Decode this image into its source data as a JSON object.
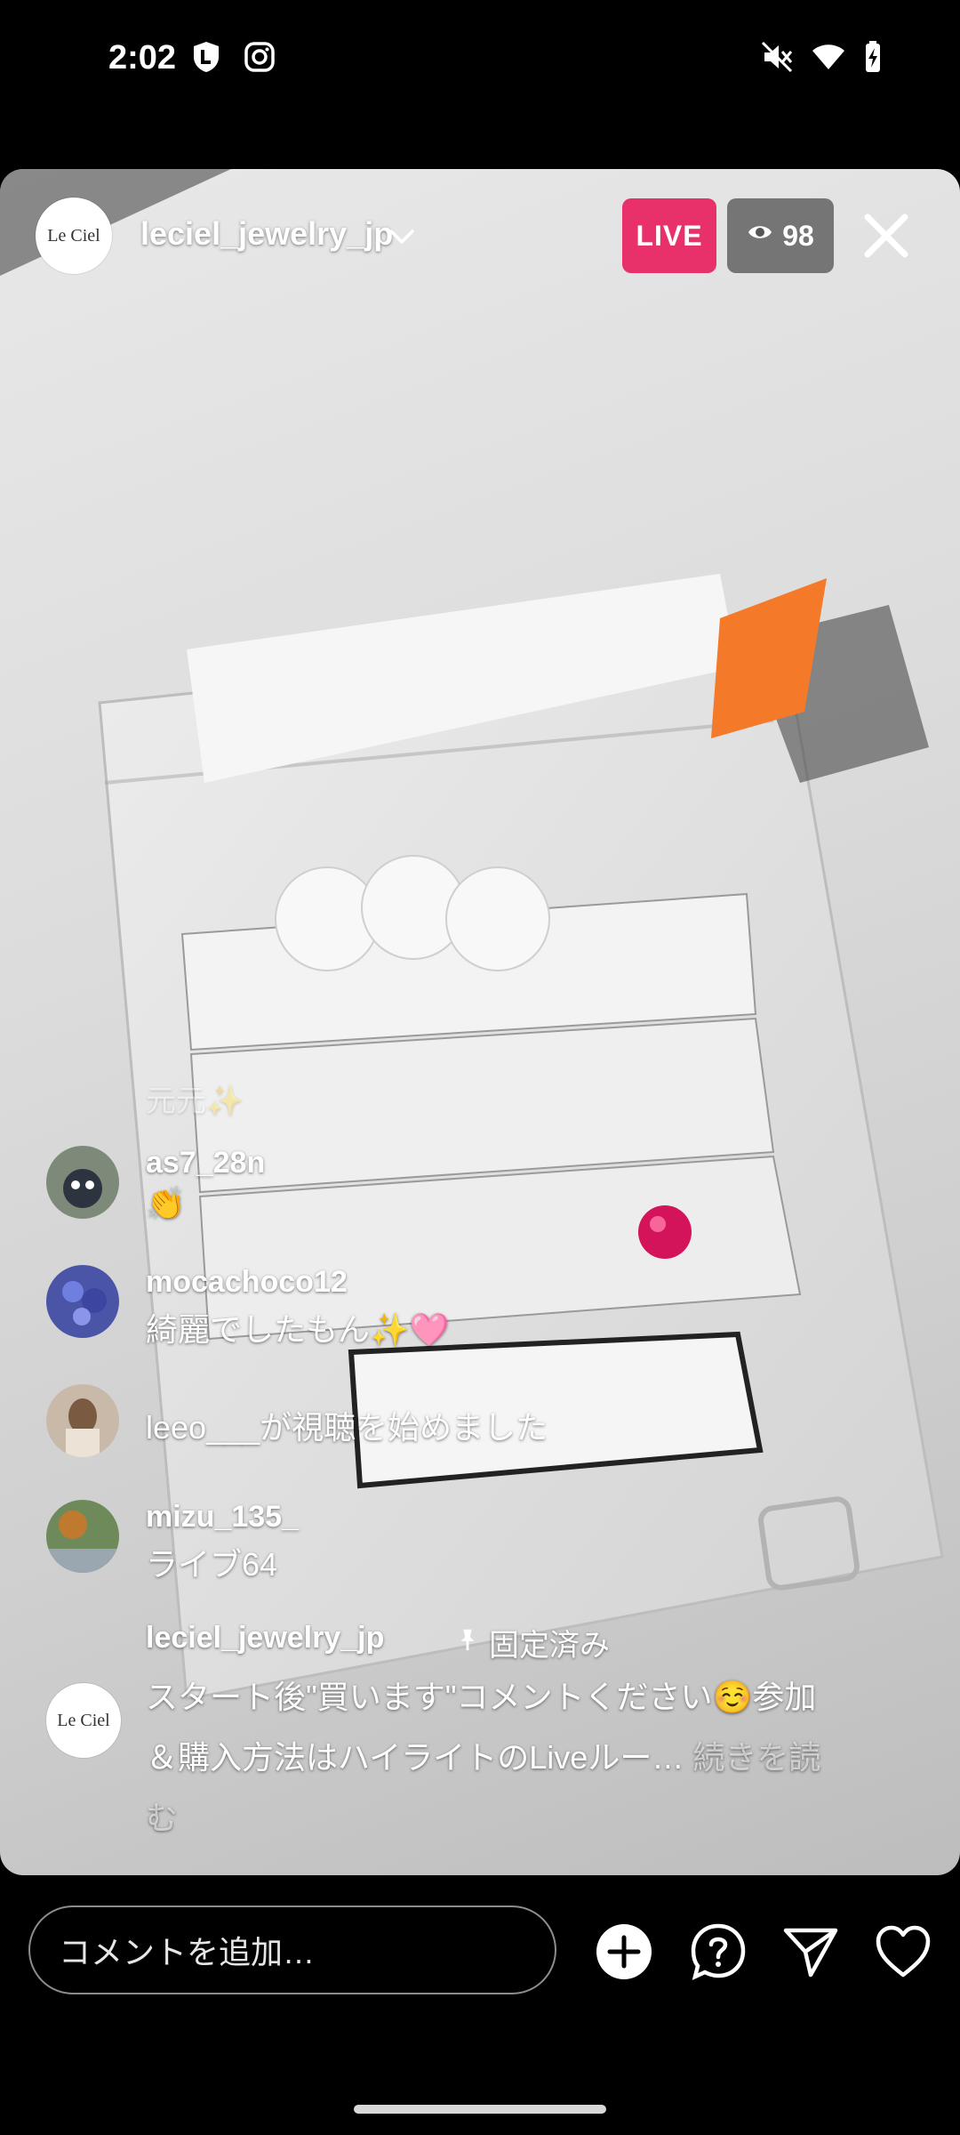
{
  "status_bar": {
    "time": "2:02",
    "icons": [
      "shield-app-icon",
      "instagram-icon",
      "mute-icon",
      "wifi-icon",
      "battery-charging-icon"
    ]
  },
  "live": {
    "host_name": "leciel_jewelry_jp",
    "host_avatar_text": "Le Ciel",
    "live_label": "LIVE",
    "viewer_count": "98",
    "accent_color": "#e8306a"
  },
  "comments": [
    {
      "username": "元元✨",
      "text": "",
      "faded": true
    },
    {
      "username": "as7_28n",
      "text": "👏"
    },
    {
      "username": "mocachoco12",
      "text": "綺麗でしたもん✨🩷"
    },
    {
      "username": "",
      "text": "leeo___が視聴を始めました"
    },
    {
      "username": "mizu_135_",
      "text": "ライブ64"
    }
  ],
  "pinned": {
    "username": "leciel_jewelry_jp",
    "pin_label": "固定済み",
    "avatar_text": "Le Ciel",
    "text": "スタート後\"買います\"コメントください☺️参加＆購入方法はハイライトのLiveルー…",
    "more_label": "続きを読む"
  },
  "bottom_bar": {
    "comment_placeholder": "コメントを追加…",
    "icons": [
      "add-icon",
      "question-icon",
      "send-icon",
      "heart-icon"
    ]
  }
}
